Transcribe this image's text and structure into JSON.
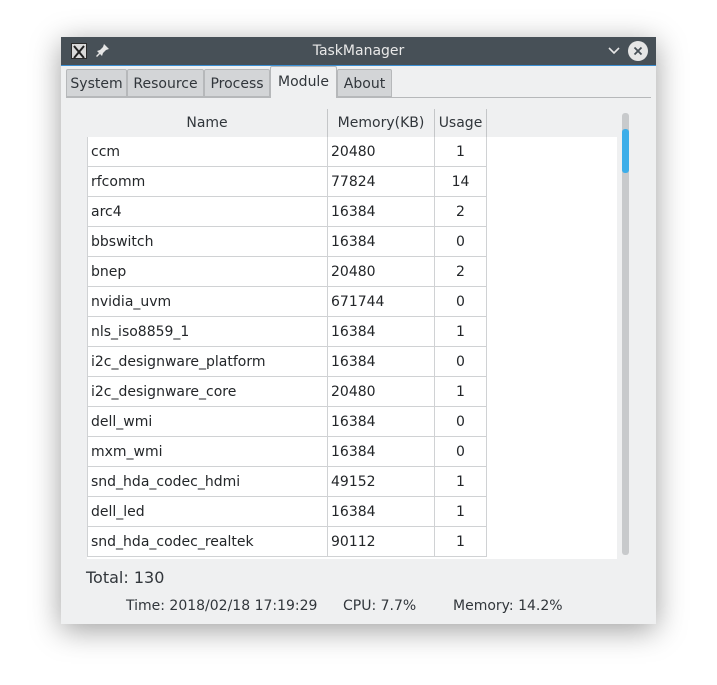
{
  "window": {
    "title": "TaskManager"
  },
  "tabs": [
    {
      "label": "System"
    },
    {
      "label": "Resource"
    },
    {
      "label": "Process"
    },
    {
      "label": "Module"
    },
    {
      "label": "About"
    }
  ],
  "active_tab": "Module",
  "table": {
    "columns": [
      "Name",
      "Memory(KB)",
      "Usage"
    ],
    "rows": [
      {
        "name": "ccm",
        "memory": "20480",
        "usage": "1"
      },
      {
        "name": "rfcomm",
        "memory": "77824",
        "usage": "14"
      },
      {
        "name": "arc4",
        "memory": "16384",
        "usage": "2"
      },
      {
        "name": "bbswitch",
        "memory": "16384",
        "usage": "0"
      },
      {
        "name": "bnep",
        "memory": "20480",
        "usage": "2"
      },
      {
        "name": "nvidia_uvm",
        "memory": "671744",
        "usage": "0"
      },
      {
        "name": "nls_iso8859_1",
        "memory": "16384",
        "usage": "1"
      },
      {
        "name": "i2c_designware_platform",
        "memory": "16384",
        "usage": "0"
      },
      {
        "name": "i2c_designware_core",
        "memory": "20480",
        "usage": "1"
      },
      {
        "name": "dell_wmi",
        "memory": "16384",
        "usage": "0"
      },
      {
        "name": "mxm_wmi",
        "memory": "16384",
        "usage": "0"
      },
      {
        "name": "snd_hda_codec_hdmi",
        "memory": "49152",
        "usage": "1"
      },
      {
        "name": "dell_led",
        "memory": "16384",
        "usage": "1"
      },
      {
        "name": "snd_hda_codec_realtek",
        "memory": "90112",
        "usage": "1"
      }
    ]
  },
  "total": "Total: 130",
  "status": {
    "time": "Time: 2018/02/18 17:19:29",
    "cpu": "CPU: 7.7%",
    "memory": "Memory: 14.2%"
  },
  "colors": {
    "titlebar": "#475057",
    "accent": "#3daee9",
    "window_bg": "#eff0f1"
  }
}
